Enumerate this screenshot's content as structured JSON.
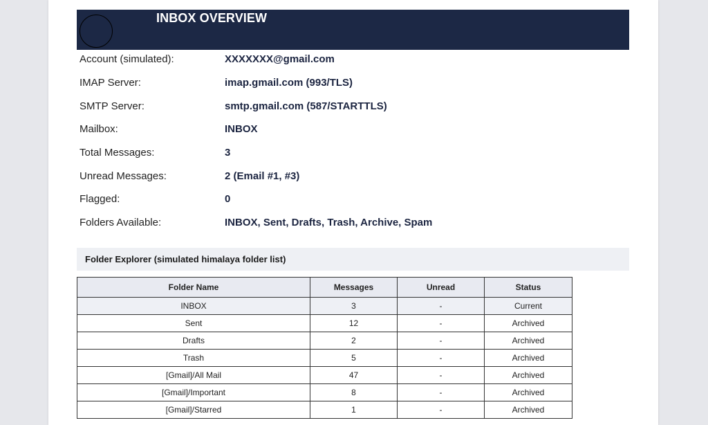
{
  "header": {
    "title": "INBOX OVERVIEW"
  },
  "info": [
    {
      "label": "Account (simulated):",
      "value": "XXXXXXX@gmail.com"
    },
    {
      "label": "IMAP Server:",
      "value": "imap.gmail.com (993/TLS)"
    },
    {
      "label": "SMTP Server:",
      "value": "smtp.gmail.com (587/STARTTLS)"
    },
    {
      "label": "Mailbox:",
      "value": "INBOX"
    },
    {
      "label": "Total Messages:",
      "value": "3"
    },
    {
      "label": "Unread Messages:",
      "value": "2 (Email #1, #3)"
    },
    {
      "label": "Flagged:",
      "value": "0"
    },
    {
      "label": "Folders Available:",
      "value": "INBOX, Sent, Drafts, Trash, Archive, Spam"
    }
  ],
  "folder_explorer": {
    "title": "Folder Explorer (simulated himalaya folder list)",
    "columns": [
      "Folder Name",
      "Messages",
      "Unread",
      "Status"
    ],
    "rows": [
      [
        "INBOX",
        "3",
        "-",
        "Current"
      ],
      [
        "Sent",
        "12",
        "-",
        "Archived"
      ],
      [
        "Drafts",
        "2",
        "-",
        "Archived"
      ],
      [
        "Trash",
        "5",
        "-",
        "Archived"
      ],
      [
        "[Gmail]/All Mail",
        "47",
        "-",
        "Archived"
      ],
      [
        "[Gmail]/Important",
        "8",
        "-",
        "Archived"
      ],
      [
        "[Gmail]/Starred",
        "1",
        "-",
        "Archived"
      ]
    ]
  },
  "colors": {
    "header_bg": "#1c2845",
    "value_text": "#1b2440",
    "section_bg": "#eef0f4",
    "page_bg": "#e6e7eb"
  }
}
